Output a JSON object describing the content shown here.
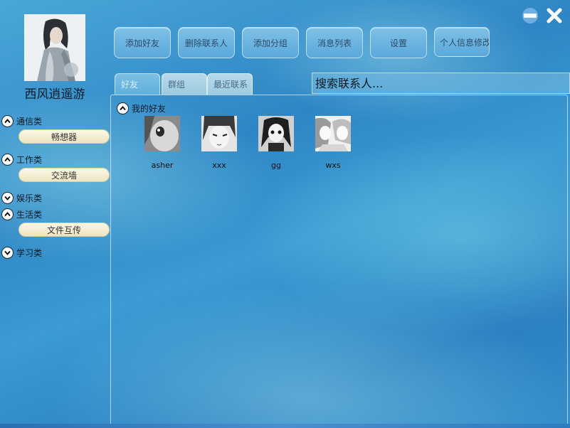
{
  "user": {
    "name": "西风逍遥游"
  },
  "toolbar": {
    "add_friend": "添加好友",
    "delete_contact": "删除联系人",
    "add_group": "添加分组",
    "message_list": "消息列表",
    "settings": "设置",
    "edit_profile": "个人信息修改"
  },
  "tabs": [
    "好友",
    "群组",
    "最近联系"
  ],
  "search": {
    "placeholder": "搜索联系人..."
  },
  "sidebar": {
    "categories": [
      {
        "label": "通信类",
        "items": [
          "畅想器"
        ]
      },
      {
        "label": "工作类",
        "items": [
          "交流墙"
        ]
      },
      {
        "label": "娱乐类",
        "items": []
      },
      {
        "label": "生活类",
        "items": [
          "文件互传"
        ]
      },
      {
        "label": "学习类",
        "items": []
      }
    ]
  },
  "friends_group": {
    "title": "我的好友",
    "friends": [
      "asher",
      "xxx",
      "gg",
      "wxs"
    ]
  },
  "window": {
    "minimize_icon": "minimize-icon",
    "close_icon": "close-icon"
  }
}
